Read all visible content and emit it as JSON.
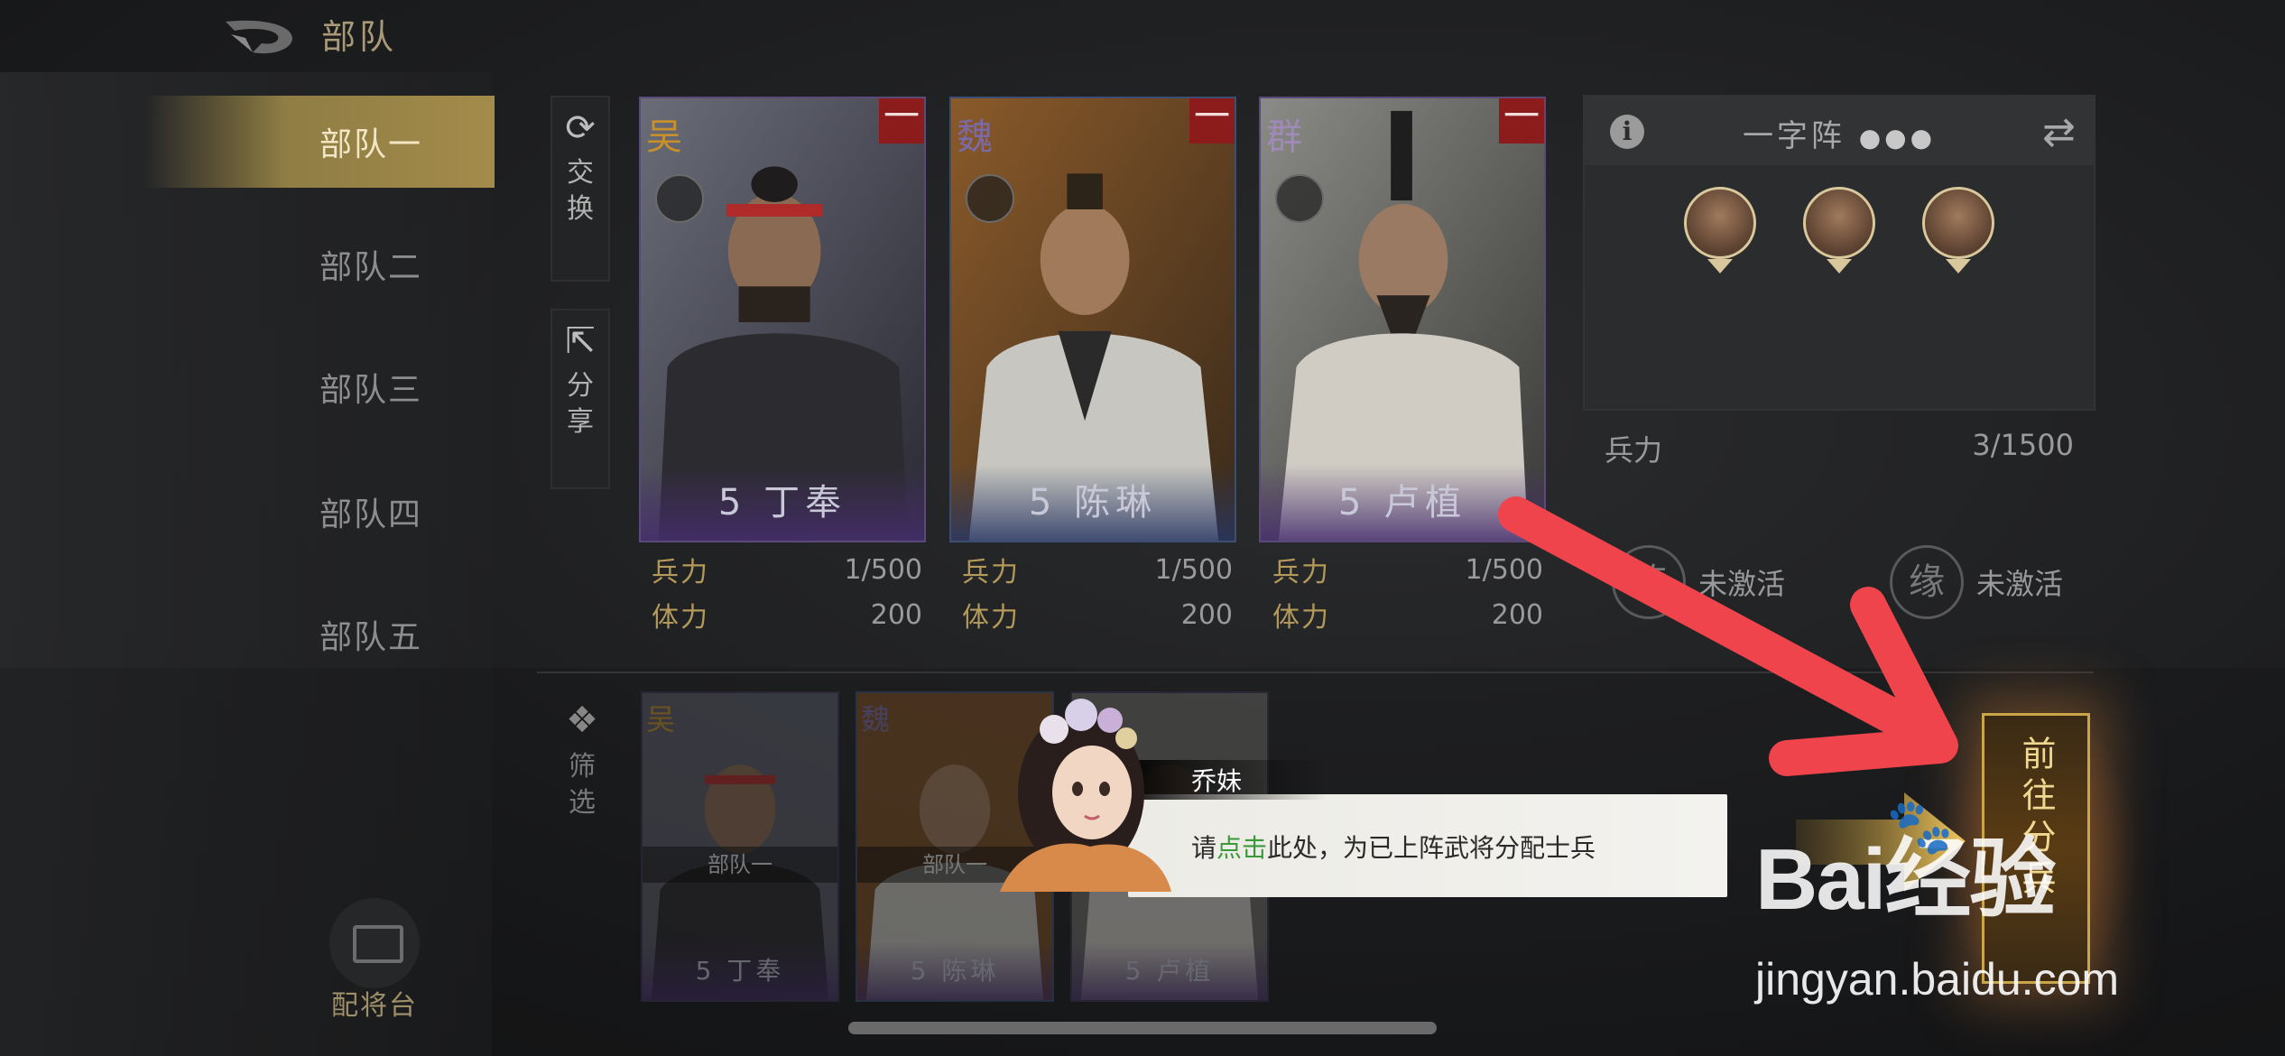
{
  "header": {
    "title": "部队"
  },
  "sidebar": {
    "items": [
      {
        "label": "部队一",
        "active": true
      },
      {
        "label": "部队二",
        "active": false
      },
      {
        "label": "部队三",
        "active": false
      },
      {
        "label": "部队四",
        "active": false
      },
      {
        "label": "部队五",
        "active": false
      }
    ],
    "deploy_label": "配将台"
  },
  "side_buttons": {
    "exchange": "交换",
    "share": "分享",
    "filter": "筛选"
  },
  "cards": [
    {
      "faction": "吴",
      "level_name": "5 丁奉",
      "troops_label": "兵力",
      "troops_value": "1/500",
      "stamina_label": "体力",
      "stamina_value": "200",
      "badge": "一",
      "frame_color": "#5a4a7a"
    },
    {
      "faction": "魏",
      "level_name": "5 陈琳",
      "troops_label": "兵力",
      "troops_value": "1/500",
      "stamina_label": "体力",
      "stamina_value": "200",
      "badge": "一",
      "frame_color": "#3d4e72"
    },
    {
      "faction": "群",
      "level_name": "5 卢植",
      "troops_label": "兵力",
      "troops_value": "1/500",
      "stamina_label": "体力",
      "stamina_value": "200",
      "badge": "一",
      "frame_color": "#5a4a7a"
    }
  ],
  "formation": {
    "name": "一字阵",
    "info_icon": "info-icon",
    "swap_icon": "swap-icon",
    "troops_label": "兵力",
    "troops_value": "3/1500",
    "activations": [
      {
        "ring": "阵",
        "label": "未激活"
      },
      {
        "ring": "缘",
        "label": "未激活"
      }
    ]
  },
  "roster": [
    {
      "faction": "吴",
      "team": "部队一",
      "name": "5 丁奉"
    },
    {
      "faction": "魏",
      "team": "部队一",
      "name": "5 陈琳"
    },
    {
      "faction": "",
      "team": "",
      "name": "5 卢植"
    }
  ],
  "tutorial": {
    "speaker": "乔妹",
    "text_prefix": "请",
    "text_highlight": "点击",
    "text_suffix": "此处，为已上阵武将分配士兵"
  },
  "goto_button": {
    "label": "前往分兵"
  },
  "watermark": {
    "logo": "Bai经验",
    "url": "jingyan.baidu.com"
  },
  "colors": {
    "accent_gold": "#a38b4a",
    "highlight_green": "#3a9a3a",
    "badge_red": "#8c1c1c",
    "arrow_red": "#f0444c"
  }
}
